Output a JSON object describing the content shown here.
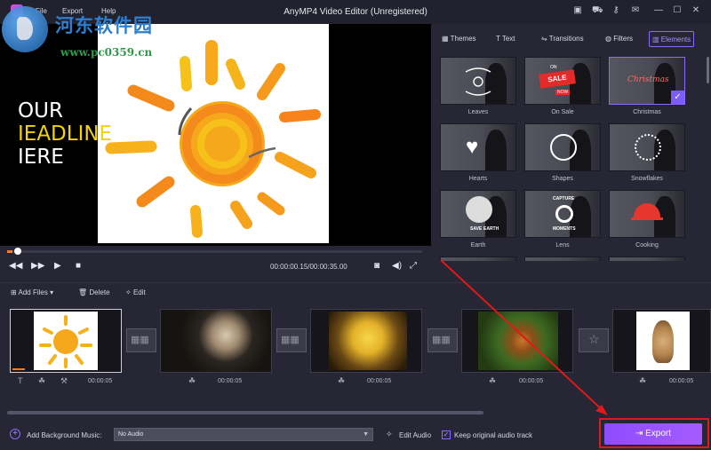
{
  "menu": {
    "file": "File",
    "export": "Export",
    "help": "Help"
  },
  "title": "AnyMP4 Video Editor (Unregistered)",
  "watermark": {
    "cn": "河东软件园",
    "url": "www.pc0359.cn"
  },
  "preview": {
    "headline": [
      "OUR",
      "IEADLINE",
      "IERE"
    ],
    "timecode": "00:00:00.15/00:00:35.00",
    "progress_fraction": 0.004
  },
  "tabs": [
    {
      "label": "Themes",
      "icon": "themes-icon"
    },
    {
      "label": "Text",
      "icon": "text-icon"
    },
    {
      "label": "Transitions",
      "icon": "transitions-icon"
    },
    {
      "label": "Filters",
      "icon": "filters-icon"
    },
    {
      "label": "Elements",
      "icon": "elements-icon",
      "active": true
    }
  ],
  "elements": [
    {
      "label": "Leaves"
    },
    {
      "label": "On Sale"
    },
    {
      "label": "Christmas",
      "selected": true
    },
    {
      "label": "Hearts"
    },
    {
      "label": "Shapes"
    },
    {
      "label": "Snowflakes"
    },
    {
      "label": "Earth"
    },
    {
      "label": "Lens"
    },
    {
      "label": "Cooking"
    }
  ],
  "thumb_text": {
    "sale_top": "ON",
    "sale": "SALE",
    "sale_bottom": "NOW",
    "christmas": "Christmas",
    "capture": "CAPTURE",
    "moments": "MOMENTS",
    "save": "SAVE",
    "earth": "EARTH"
  },
  "timeline_toolbar": {
    "add_files": "Add Files",
    "delete": "Delete",
    "edit": "Edit"
  },
  "clips": [
    {
      "duration": "00:00:05"
    },
    {
      "duration": "00:00:05"
    },
    {
      "duration": "00:00:05"
    },
    {
      "duration": "00:00:05"
    },
    {
      "duration": "00:00:05"
    }
  ],
  "bottom": {
    "bg_music_label": "Add Background Music:",
    "bg_music_value": "No Audio",
    "edit_audio": "Edit Audio",
    "keep_audio": "Keep original audio track",
    "keep_audio_checked": true,
    "export": "Export"
  },
  "colors": {
    "accent": "#8b6bff",
    "export": "#9a55ff",
    "highlight": "#e01a1a",
    "progress": "#ff7a1a"
  }
}
